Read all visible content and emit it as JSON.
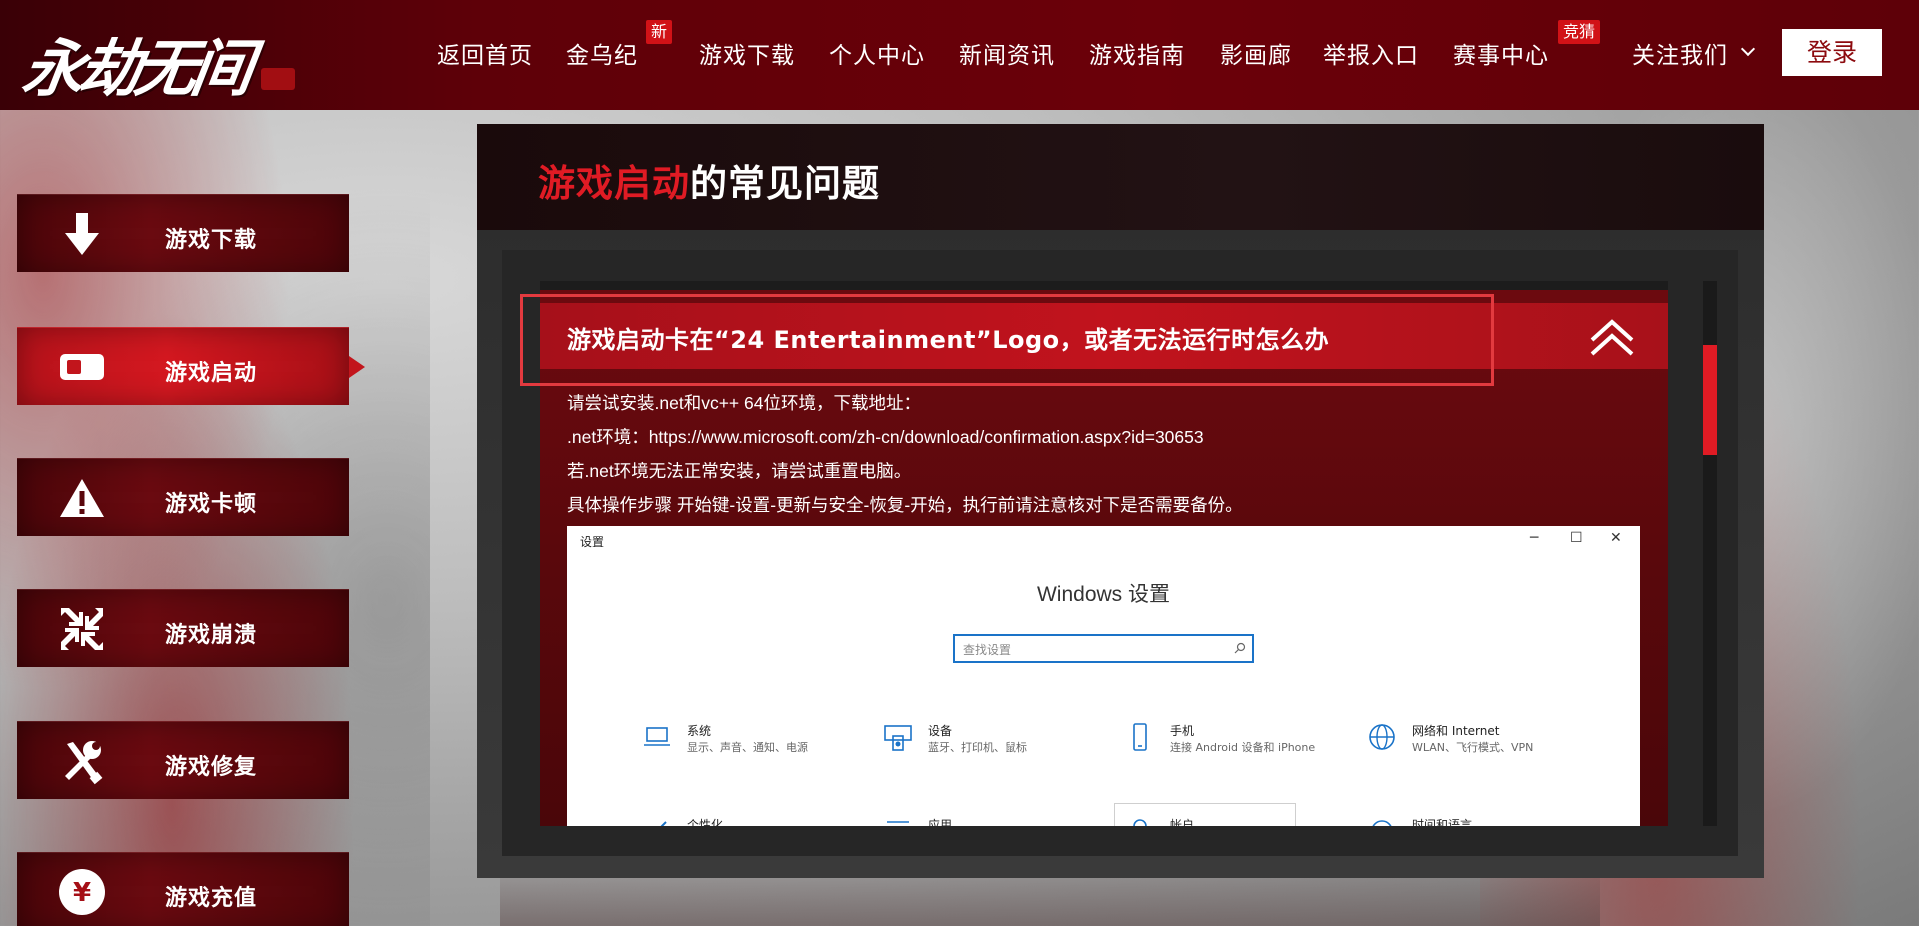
{
  "brand": {
    "logo_alt": "永劫无间"
  },
  "nav": {
    "items": [
      {
        "label": "返回首页"
      },
      {
        "label": "金乌纪",
        "badge": "新"
      },
      {
        "label": "游戏下载"
      },
      {
        "label": "个人中心"
      },
      {
        "label": "新闻资讯"
      },
      {
        "label": "游戏指南"
      },
      {
        "label": "影画廊"
      },
      {
        "label": "举报入口"
      },
      {
        "label": "赛事中心",
        "badge": "竞猜"
      },
      {
        "label": "关注我们"
      }
    ],
    "login_label": "登录"
  },
  "sidebar": {
    "items": [
      {
        "label": "游戏下载",
        "icon": "download-arrow-icon",
        "active": false
      },
      {
        "label": "游戏启动",
        "icon": "launch-toggle-icon",
        "active": true
      },
      {
        "label": "游戏卡顿",
        "icon": "warning-icon",
        "active": false
      },
      {
        "label": "游戏崩溃",
        "icon": "collapse-arrows-icon",
        "active": false
      },
      {
        "label": "游戏修复",
        "icon": "wrench-screwdriver-icon",
        "active": false
      },
      {
        "label": "游戏充值",
        "icon": "yen-coin-icon",
        "active": false
      }
    ]
  },
  "panel": {
    "title_highlight": "游戏启动",
    "title_rest": "的常见问题",
    "question": "游戏启动卡在“24 Entertainment”Logo，或者无法运行时怎么办",
    "answer_lines": [
      "请尝试安装.net和vc++ 64位环境，下载地址：",
      ".net环境：https://www.microsoft.com/zh-cn/download/confirmation.aspx?id=30653",
      "若.net环境无法正常安装，请尝试重置电脑。",
      "具体操作步骤 开始键-设置-更新与安全-恢复-开始，执行前请注意核对下是否需要备份。"
    ]
  },
  "windows_screenshot": {
    "window_title": "设置",
    "heading": "Windows 设置",
    "search_placeholder": "查找设置",
    "tiles": [
      {
        "title": "系统",
        "subtitle": "显示、声音、通知、电源",
        "icon": "laptop-icon"
      },
      {
        "title": "设备",
        "subtitle": "蓝牙、打印机、鼠标",
        "icon": "keyboard-icon"
      },
      {
        "title": "手机",
        "subtitle": "连接 Android 设备和 iPhone",
        "icon": "phone-icon"
      },
      {
        "title": "网络和 Internet",
        "subtitle": "WLAN、飞行模式、VPN",
        "icon": "globe-icon"
      },
      {
        "title": "个性化",
        "subtitle": "",
        "icon": "pen-icon"
      },
      {
        "title": "应用",
        "subtitle": "",
        "icon": "list-icon"
      },
      {
        "title": "帐户",
        "subtitle": "",
        "icon": "account-icon"
      },
      {
        "title": "时间和语言",
        "subtitle": "",
        "icon": "clock-icon"
      }
    ]
  },
  "colors": {
    "brand_red": "#e01b24",
    "nav_bg": "#6b0009",
    "win_accent": "#1a73c8"
  }
}
